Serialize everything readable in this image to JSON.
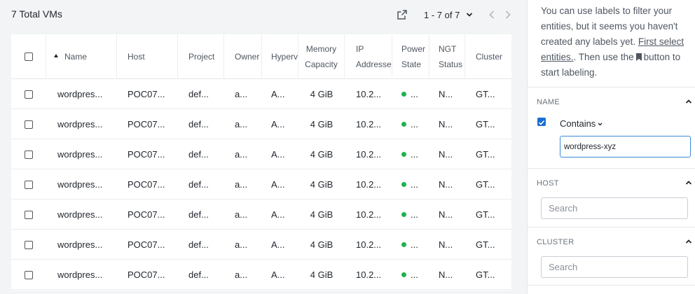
{
  "header": {
    "total_label": "7 Total VMs",
    "pager_label": "1 - 7 of 7"
  },
  "table": {
    "columns": [
      {
        "key": "select",
        "label": ""
      },
      {
        "key": "name",
        "label": "Name"
      },
      {
        "key": "host",
        "label": "Host"
      },
      {
        "key": "project",
        "label": "Project"
      },
      {
        "key": "owner",
        "label": "Owner"
      },
      {
        "key": "hypervisor",
        "label": "Hyperv"
      },
      {
        "key": "memory",
        "label": "Memory Capacity"
      },
      {
        "key": "ip",
        "label": "IP Addresse"
      },
      {
        "key": "power",
        "label": "Power State"
      },
      {
        "key": "ngt",
        "label": "NGT Status"
      },
      {
        "key": "cluster",
        "label": "Cluster"
      }
    ],
    "rows": [
      {
        "name": "wordpres...",
        "host": "POC07...",
        "project": "def...",
        "owner": "a...",
        "hypervisor": "A...",
        "memory": "4 GiB",
        "ip": "10.2...",
        "power": "...",
        "ngt": "N...",
        "cluster": "GT..."
      },
      {
        "name": "wordpres...",
        "host": "POC07...",
        "project": "def...",
        "owner": "a...",
        "hypervisor": "A...",
        "memory": "4 GiB",
        "ip": "10.2...",
        "power": "...",
        "ngt": "N...",
        "cluster": "GT..."
      },
      {
        "name": "wordpres...",
        "host": "POC07...",
        "project": "def...",
        "owner": "a...",
        "hypervisor": "A...",
        "memory": "4 GiB",
        "ip": "10.2...",
        "power": "...",
        "ngt": "N...",
        "cluster": "GT..."
      },
      {
        "name": "wordpres...",
        "host": "POC07...",
        "project": "def...",
        "owner": "a...",
        "hypervisor": "A...",
        "memory": "4 GiB",
        "ip": "10.2...",
        "power": "...",
        "ngt": "N...",
        "cluster": "GT..."
      },
      {
        "name": "wordpres...",
        "host": "POC07...",
        "project": "def...",
        "owner": "a...",
        "hypervisor": "A...",
        "memory": "4 GiB",
        "ip": "10.2...",
        "power": "...",
        "ngt": "N...",
        "cluster": "GT..."
      },
      {
        "name": "wordpres...",
        "host": "POC07...",
        "project": "def...",
        "owner": "a...",
        "hypervisor": "A...",
        "memory": "4 GiB",
        "ip": "10.2...",
        "power": "...",
        "ngt": "N...",
        "cluster": "GT..."
      },
      {
        "name": "wordpres...",
        "host": "POC07...",
        "project": "def...",
        "owner": "a...",
        "hypervisor": "A...",
        "memory": "4 GiB",
        "ip": "10.2...",
        "power": "...",
        "ngt": "N...",
        "cluster": "GT..."
      }
    ]
  },
  "panel": {
    "info_part1": "You can use labels to filter your entities, but it seems you haven't created any labels yet. ",
    "info_link": "First select entities.",
    "info_part2": ". Then use the",
    "info_part3": "button to start labeling.",
    "sections": {
      "name": {
        "title": "NAME",
        "operator": "Contains",
        "value": "wordpress-xyz"
      },
      "host": {
        "title": "HOST",
        "placeholder": "Search"
      },
      "cluster": {
        "title": "CLUSTER",
        "placeholder": "Search"
      }
    }
  },
  "colors": {
    "accent": "#1b6fd3",
    "power_on": "#1bb44e",
    "page_bg": "#f2f4f6"
  },
  "icons": [
    "export-icon",
    "chevron-down-icon",
    "chevron-left-icon",
    "chevron-right-icon",
    "sort-asc-icon",
    "bookmark-icon",
    "chevron-up-icon",
    "checkbox-checked-icon"
  ]
}
